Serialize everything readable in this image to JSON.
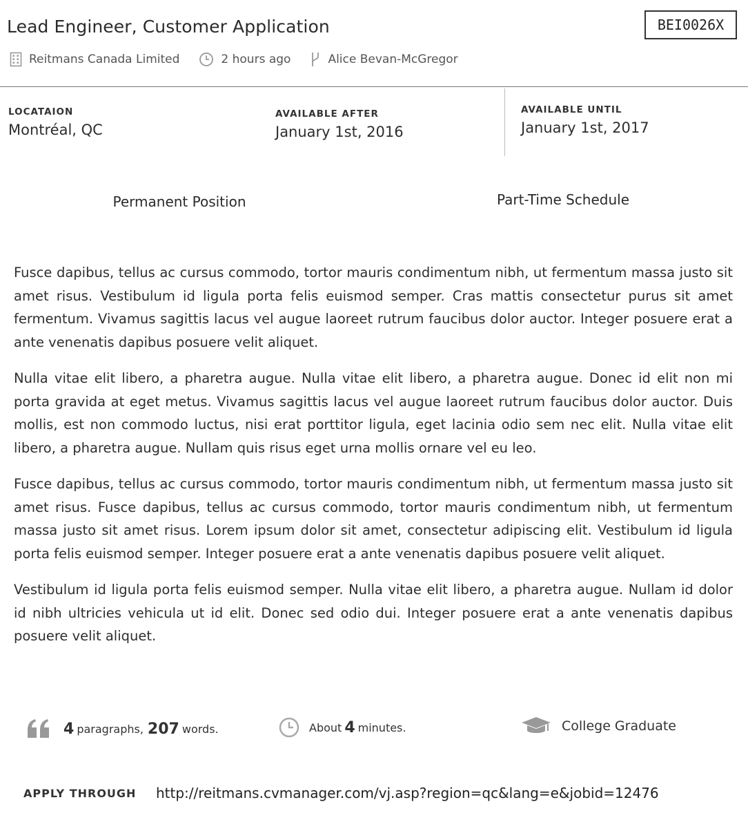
{
  "header": {
    "title": "Lead Engineer, Customer Application",
    "ref_code": "BEI0026X",
    "company": "Reitmans Canada Limited",
    "posted": "2 hours ago",
    "contact": "Alice Bevan-McGregor"
  },
  "details": {
    "location_label": "LOCATAION",
    "location_value": "Montréal, QC",
    "after_label": "AVAILABLE AFTER",
    "after_value": "January 1st, 2016",
    "until_label": "AVAILABLE UNTIL",
    "until_value": "January 1st, 2017"
  },
  "position": {
    "type": "Permanent Position",
    "schedule": "Part-Time Schedule"
  },
  "description": [
    "Fusce dapibus, tellus ac cursus commodo, tortor mauris condimentum nibh, ut fermentum massa justo sit amet risus. Vestibulum id ligula porta felis euismod semper. Cras mattis consectetur purus sit amet fermentum. Vivamus sagittis lacus vel augue laoreet rutrum faucibus dolor auctor. Integer posuere erat a ante venenatis dapibus posuere velit aliquet.",
    "Nulla vitae elit libero, a pharetra augue. Nulla vitae elit libero, a pharetra augue. Donec id elit non mi porta gravida at eget metus. Vivamus sagittis lacus vel augue laoreet rutrum faucibus dolor auctor. Duis mollis, est non commodo luctus, nisi erat porttitor ligula, eget lacinia odio sem nec elit. Nulla vitae elit libero, a pharetra augue. Nullam quis risus eget urna mollis ornare vel eu leo.",
    "Fusce dapibus, tellus ac cursus commodo, tortor mauris condimentum nibh, ut fermentum massa justo sit amet risus. Fusce dapibus, tellus ac cursus commodo, tortor mauris condimentum nibh, ut fermentum massa justo sit amet risus. Lorem ipsum dolor sit amet, consectetur adipiscing elit. Vestibulum id ligula porta felis euismod semper. Integer posuere erat a ante venenatis dapibus posuere velit aliquet.",
    "Vestibulum id ligula porta felis euismod semper. Nulla vitae elit libero, a pharetra augue. Nullam id dolor id nibh ultricies vehicula ut id elit. Donec sed odio dui. Integer posuere erat a ante venenatis dapibus posuere velit aliquet."
  ],
  "stats": {
    "paragraph_count": "4",
    "paragraphs_word": "paragraphs,",
    "word_count": "207",
    "words_word": "words.",
    "reading_prefix": "About",
    "reading_minutes": "4",
    "reading_suffix": "minutes.",
    "education": "College Graduate"
  },
  "apply": {
    "label": "APPLY THROUGH",
    "url": "http://reitmans.cvmanager.com/vj.asp?region=qc&lang=e&jobid=12476"
  },
  "icons": {
    "company": "building-icon",
    "posted": "clock-icon",
    "contact": "branch-icon",
    "paragraphs": "quote-icon",
    "reading": "clock-icon",
    "education": "graduation-cap-icon"
  },
  "colors": {
    "icon_gray": "#999999",
    "text": "#2e2e2e"
  }
}
